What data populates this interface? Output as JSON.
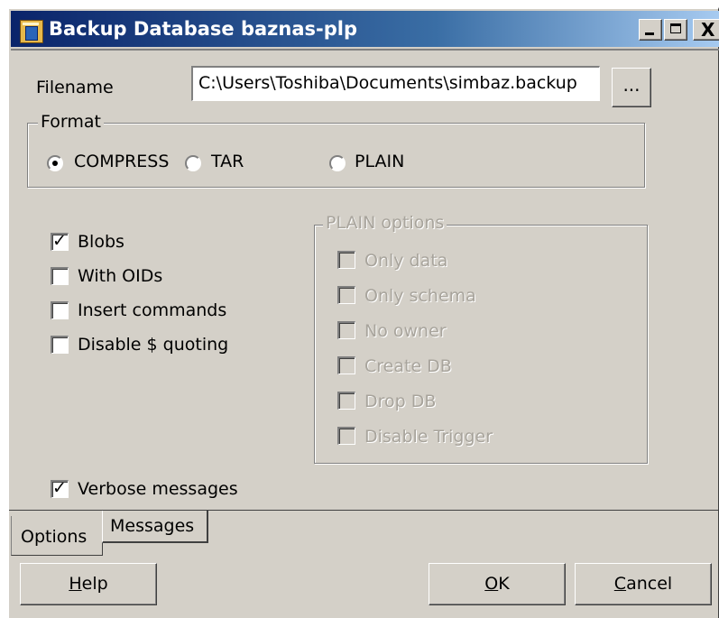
{
  "window": {
    "title": "Backup Database baznas-plp"
  },
  "titlebar_buttons": {
    "minimize": "_",
    "maximize": "□",
    "close": "X"
  },
  "filename": {
    "label": "Filename",
    "value": "C:\\Users\\Toshiba\\Documents\\simbaz.backup",
    "browse_label": "..."
  },
  "format": {
    "title": "Format",
    "options": [
      {
        "label": "COMPRESS",
        "selected": true
      },
      {
        "label": "TAR",
        "selected": false
      },
      {
        "label": "PLAIN",
        "selected": false
      }
    ]
  },
  "options": [
    {
      "label": "Blobs",
      "checked": true
    },
    {
      "label": "With OIDs",
      "checked": false
    },
    {
      "label": "Insert commands",
      "checked": false
    },
    {
      "label": "Disable $ quoting",
      "checked": false
    }
  ],
  "plain_options": {
    "title": "PLAIN options",
    "items": [
      {
        "label": "Only data",
        "checked": false
      },
      {
        "label": "Only schema",
        "checked": false
      },
      {
        "label": "No owner",
        "checked": false
      },
      {
        "label": "Create DB",
        "checked": false
      },
      {
        "label": "Drop DB",
        "checked": false
      },
      {
        "label": "Disable Trigger",
        "checked": false
      }
    ]
  },
  "verbose": {
    "label": "Verbose messages",
    "checked": true
  },
  "tabs": [
    {
      "label": "Options",
      "active": true
    },
    {
      "label": "Messages",
      "active": false
    }
  ],
  "buttons": {
    "help_hotkey": "H",
    "help_rest": "elp",
    "ok_hotkey": "O",
    "ok_rest": "K",
    "cancel_hotkey": "C",
    "cancel_rest": "ancel"
  }
}
